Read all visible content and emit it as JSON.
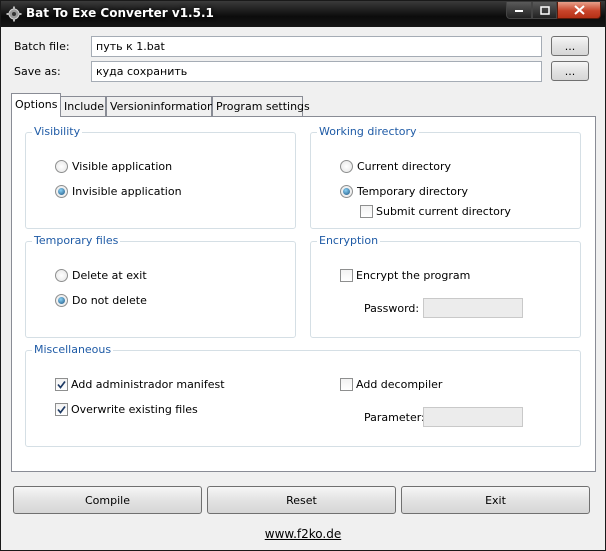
{
  "window": {
    "title": "Bat To Exe Converter v1.5.1"
  },
  "form": {
    "batch_file_label": "Batch file:",
    "batch_file_value": "путь к 1.bat",
    "save_as_label": "Save as:",
    "save_as_value": "куда сохранить",
    "browse_label": "..."
  },
  "tabs": [
    {
      "label": "Options",
      "active": true
    },
    {
      "label": "Include",
      "active": false
    },
    {
      "label": "Versioninformations",
      "active": false
    },
    {
      "label": "Program settings",
      "active": false
    }
  ],
  "visibility": {
    "title": "Visibility",
    "options": [
      {
        "label": "Visible application",
        "checked": false
      },
      {
        "label": "Invisible application",
        "checked": true
      }
    ]
  },
  "working_directory": {
    "title": "Working directory",
    "options": [
      {
        "label": "Current directory",
        "checked": false
      },
      {
        "label": "Temporary directory",
        "checked": true
      }
    ],
    "submit_label": "Submit current directory",
    "submit_checked": false
  },
  "temporary_files": {
    "title": "Temporary files",
    "options": [
      {
        "label": "Delete at exit",
        "checked": false
      },
      {
        "label": "Do not delete",
        "checked": true
      }
    ]
  },
  "encryption": {
    "title": "Encryption",
    "encrypt_label": "Encrypt the program",
    "encrypt_checked": false,
    "password_label": "Password:",
    "password_value": ""
  },
  "misc": {
    "title": "Miscellaneous",
    "admin_manifest_label": "Add administrador manifest",
    "admin_manifest_checked": true,
    "overwrite_label": "Overwrite existing files",
    "overwrite_checked": true,
    "decompiler_label": "Add decompiler",
    "decompiler_checked": false,
    "parameter_label": "Parameter:",
    "parameter_value": ""
  },
  "buttons": {
    "compile": "Compile",
    "reset": "Reset",
    "exit": "Exit"
  },
  "footer": {
    "link": "www.f2ko.de"
  },
  "colors": {
    "group_title": "#1f5ba6",
    "close_button": "#c8442a"
  }
}
